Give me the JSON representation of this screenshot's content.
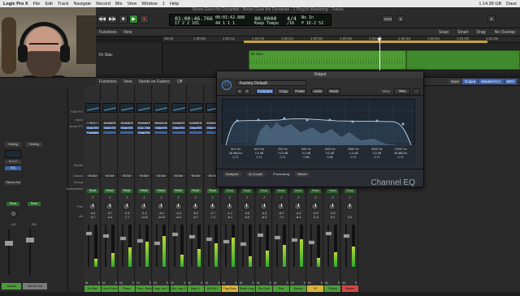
{
  "menubar": {
    "items": [
      "Logic Pro X",
      "File",
      "Edit",
      "Track",
      "Navigate",
      "Record",
      "Mix",
      "View",
      "Window",
      "1",
      "Help"
    ],
    "right": [
      "1.14.38 GB",
      "Dave"
    ]
  },
  "controlbar": {
    "window_title": "Boom Goes the Dynamite - Boom Goes the Dynamite - 2 Plug In Mastering - Tracks",
    "transport": [
      "rewind",
      "forward",
      "stop",
      "play",
      "record"
    ],
    "lcd": {
      "time": "01:00:46.766",
      "time2": "00:01:42.888",
      "bars": "17 2 2 101",
      "bars2": "44 1 1 1",
      "tempo": "80.0000",
      "tempo_label": "Keep Tempo",
      "sig": "4/4",
      "div": "/16",
      "out": "No In",
      "key": "P 1E-2 52"
    },
    "right_buttons": [
      "1234",
      "6",
      "9"
    ]
  },
  "tracks": {
    "header_items": [
      "Functions",
      "View"
    ],
    "right_items": [
      "Snap:",
      "Smart",
      "Drag:",
      "No Overlap"
    ],
    "ruler_ticks": [
      "00:00",
      "1:00:06",
      "1:00:12",
      "1:00:18",
      "1:00:24",
      "1:00:30",
      "1:00:36",
      "1:00:42",
      "1:00:48",
      "1:00:54",
      "1:01:00",
      "1:01:06"
    ],
    "track_name": "Dr Stac",
    "region_name": "Dr Stac"
  },
  "mixer": {
    "bar_items": [
      "Functions",
      "View",
      "Sends on Faders:",
      "Off"
    ],
    "view_buttons": [
      "Input",
      "Output",
      "Master/VCA",
      "MIDI"
    ],
    "row_labels": [
      "MIDI FX",
      "Input",
      "Audio FX",
      "Sends",
      "Output",
      "Group",
      "Automation",
      "Pan",
      "dB"
    ],
    "inspector": {
      "setting": "Setting",
      "eq_label": "EQ",
      "input": "In 1-2",
      "audio_fx": "Stereo Out",
      "read": "Read",
      "pan_val": "-0.0",
      "db_val": "-1.2",
      "label2_db": "0.0",
      "name1": "Sweep",
      "name2": "Stereo Out"
    },
    "strips": [
      {
        "name": "Dr Stac",
        "color": "#4f9a3a",
        "input": "In 1",
        "fx1": "Chan EQ",
        "fx2": "Transient",
        "output": "St Out",
        "pan": "-4.4",
        "db": "-5.7"
      },
      {
        "name": "Orch Short",
        "color": "#4f9a3a",
        "input": "Kontakt 5",
        "fx1": "Chan EQ",
        "fx2": "",
        "output": "St Out",
        "pan": "-3.7",
        "db": "-4.4"
      },
      {
        "name": "Piano",
        "color": "#4f9a3a",
        "input": "Kontakt 5",
        "fx1": "Chan EQ",
        "fx2": "",
        "output": "St Out",
        "pan": "-3.4",
        "db": "-7.7"
      },
      {
        "name": "Tubu...Bells",
        "color": "#4f9a3a",
        "input": "Kontakt 5",
        "fx1": "CLA...Tect",
        "fx2": "Chan EQ",
        "output": "St Out",
        "pan": "-2.4",
        "db": "-11.8"
      },
      {
        "name": "Mag...ine 1",
        "color": "#4f9a3a",
        "input": "Vienna Ins",
        "fx1": "Chan EQ",
        "fx2": "",
        "output": "St Out",
        "pan": "-3.4",
        "db": "-10.8"
      },
      {
        "name": "Glic...ops 1",
        "color": "#4f9a3a",
        "input": "Kontakt 5",
        "fx1": "Chan EQ",
        "fx2": "",
        "output": "St Out",
        "pan": "-4.4",
        "db": "-8.4"
      },
      {
        "name": "Bass 1",
        "color": "#4f9a3a",
        "input": "Kontakt 5",
        "fx1": "Chan EQ",
        "fx2": "",
        "output": "St Out",
        "pan": "-5.2",
        "db": "-6.7"
      },
      {
        "name": "808 Kit 1",
        "color": "#4f9a3a",
        "input": "Kontakt 5",
        "fx1": "Chan EQ",
        "fx2": "",
        "output": "St Out",
        "pan": "-2.7",
        "db": "-7.2"
      },
      {
        "name": "Trap Door",
        "color": "#d8b43a",
        "input": "",
        "fx1": "Chan EQ",
        "fx2": "",
        "output": "St Out",
        "pan": "-1.1",
        "db": "-6.1"
      },
      {
        "name": "Snare Loop",
        "color": "#4f9a3a",
        "input": "",
        "fx1": "Chan EQ",
        "fx2": "",
        "output": "St Out",
        "pan": "-3.4",
        "db": "-6.0"
      },
      {
        "name": "Sus Cym",
        "color": "#4f9a3a",
        "input": "",
        "fx1": "Chan EQ",
        "fx2": "",
        "output": "St Out",
        "pan": "-4.4",
        "db": "-8.2"
      },
      {
        "name": "Pan",
        "color": "#4f9a3a",
        "input": "",
        "fx1": "",
        "fx2": "",
        "output": "St Out",
        "pan": "-6.2",
        "db": "-7.1"
      },
      {
        "name": "Sweep",
        "color": "#4f9a3a",
        "input": "",
        "fx1": "",
        "fx2": "",
        "output": "St Out",
        "pan": "-4.4",
        "db": "-6.4"
      },
      {
        "name": "FC",
        "color": "#d8b43a",
        "input": "",
        "fx1": "",
        "fx2": "",
        "output": "St Out",
        "pan": "-0.5",
        "db": "-0.3"
      },
      {
        "name": "Output",
        "color": "#4f9a3a",
        "input": "",
        "fx1": "",
        "fx2": "",
        "output": "",
        "pan": "-0.3",
        "db": "0.0"
      },
      {
        "name": "Master",
        "color": "#d04848",
        "input": "",
        "fx1": "",
        "fx2": "",
        "output": "",
        "pan": "",
        "db": "0.0"
      }
    ],
    "read_label": "Read",
    "mute_label": "M",
    "solo_label": "S"
  },
  "plugin": {
    "title": "Output",
    "preset": "Factory Default",
    "buttons": [
      "<",
      ">",
      "Compare",
      "Copy",
      "Paste",
      "Undo",
      "Redo"
    ],
    "view_label": "View:",
    "view_value": "75%",
    "params": [
      [
        "30.0 Hz",
        "48 dB/Oct",
        "0.71"
      ],
      [
        "80.0 Hz",
        "0.0 dB",
        "0.71"
      ],
      [
        "200 Hz",
        "+0.5 dB",
        "0.71"
      ],
      [
        "500 Hz",
        "0.0 dB",
        "0.98"
      ],
      [
        "1000 Hz",
        "0.0 dB",
        "0.98"
      ],
      [
        "2500 Hz",
        "-1.5 dB",
        "0.71"
      ],
      [
        "5000 Hz",
        "0.0 dB",
        "0.71"
      ],
      [
        "17000 Hz",
        "48 dB/Oct",
        "0.71"
      ]
    ],
    "footer_opts": [
      "Analyzer",
      "Q-Couple",
      "Processing:",
      "Stereo"
    ],
    "brand": "Channel EQ"
  }
}
